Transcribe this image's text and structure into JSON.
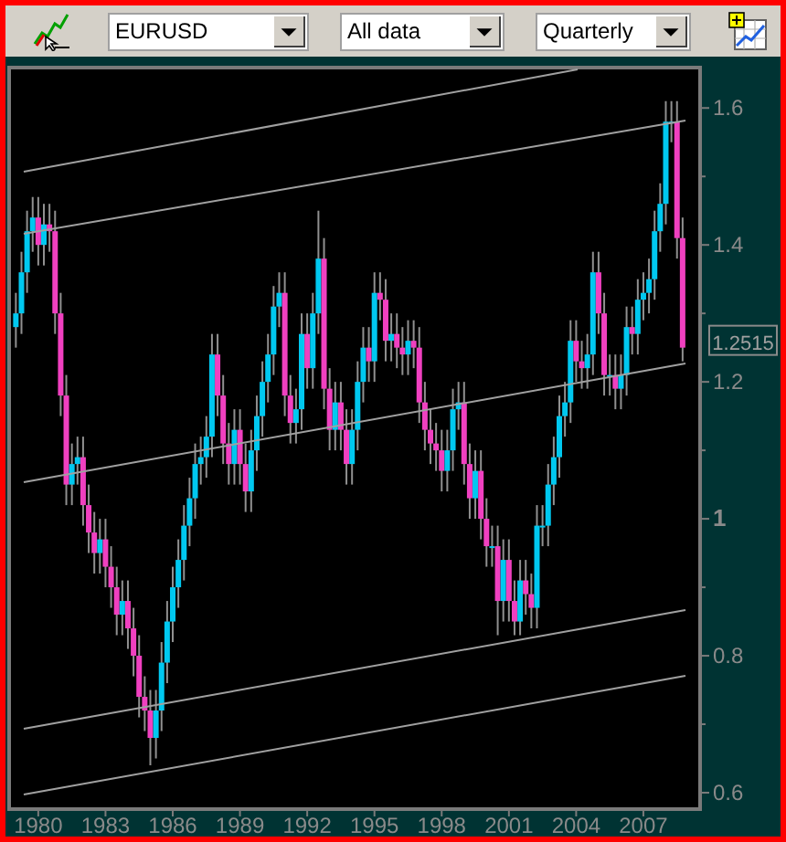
{
  "toolbar": {
    "symbol": {
      "value": "EURUSD"
    },
    "range": {
      "value": "All data"
    },
    "period": {
      "value": "Quarterly"
    }
  },
  "chart": {
    "price_label": "1.2515",
    "chart_data": {
      "type": "candlestick",
      "xlim": [
        1978.7,
        2009.53
      ],
      "ylim": [
        0.576,
        1.659
      ],
      "xticks": [
        1980,
        1983,
        1986,
        1989,
        1992,
        1995,
        1998,
        2001,
        2004,
        2007
      ],
      "yticks": [
        0.6,
        0.8,
        1,
        1.2,
        1.4,
        1.6
      ],
      "x": [
        1979,
        1979.25,
        1979.5,
        1979.75,
        1980,
        1980.25,
        1980.5,
        1980.75,
        1981,
        1981.25,
        1981.5,
        1981.75,
        1982,
        1982.25,
        1982.5,
        1982.75,
        1983,
        1983.25,
        1983.5,
        1983.75,
        1984,
        1984.25,
        1984.5,
        1984.75,
        1985,
        1985.25,
        1985.5,
        1985.75,
        1986,
        1986.25,
        1986.5,
        1986.75,
        1987,
        1987.25,
        1987.5,
        1987.75,
        1988,
        1988.25,
        1988.5,
        1988.75,
        1989,
        1989.25,
        1989.5,
        1989.75,
        1990,
        1990.25,
        1990.5,
        1990.75,
        1991,
        1991.25,
        1991.5,
        1991.75,
        1992,
        1992.25,
        1992.5,
        1992.75,
        1993,
        1993.25,
        1993.5,
        1993.75,
        1994,
        1994.25,
        1994.5,
        1994.75,
        1995,
        1995.25,
        1995.5,
        1995.75,
        1996,
        1996.25,
        1996.5,
        1996.75,
        1997,
        1997.25,
        1997.5,
        1997.75,
        1998,
        1998.25,
        1998.5,
        1998.75,
        1999,
        1999.25,
        1999.5,
        1999.75,
        2000,
        2000.25,
        2000.5,
        2000.75,
        2001,
        2001.25,
        2001.5,
        2001.75,
        2002,
        2002.25,
        2002.5,
        2002.75,
        2003,
        2003.25,
        2003.5,
        2003.75,
        2004,
        2004.25,
        2004.5,
        2004.75,
        2005,
        2005.25,
        2005.5,
        2005.75,
        2006,
        2006.25,
        2006.5,
        2006.75,
        2007,
        2007.25,
        2007.5,
        2007.75,
        2008,
        2008.25,
        2008.5,
        2008.75
      ],
      "ohlc": [
        [
          1.28,
          1.33,
          1.25,
          1.3
        ],
        [
          1.3,
          1.39,
          1.27,
          1.36
        ],
        [
          1.36,
          1.45,
          1.33,
          1.42
        ],
        [
          1.42,
          1.47,
          1.39,
          1.44
        ],
        [
          1.44,
          1.47,
          1.37,
          1.4
        ],
        [
          1.4,
          1.46,
          1.37,
          1.43
        ],
        [
          1.43,
          1.46,
          1.39,
          1.42
        ],
        [
          1.42,
          1.45,
          1.27,
          1.3
        ],
        [
          1.3,
          1.33,
          1.15,
          1.18
        ],
        [
          1.18,
          1.21,
          1.02,
          1.05
        ],
        [
          1.05,
          1.11,
          1.02,
          1.08
        ],
        [
          1.08,
          1.12,
          1.05,
          1.09
        ],
        [
          1.09,
          1.12,
          0.99,
          1.02
        ],
        [
          1.02,
          1.05,
          0.95,
          0.98
        ],
        [
          0.98,
          1.01,
          0.92,
          0.95
        ],
        [
          0.95,
          1.0,
          0.92,
          0.97
        ],
        [
          0.97,
          1.0,
          0.9,
          0.93
        ],
        [
          0.93,
          0.96,
          0.87,
          0.9
        ],
        [
          0.9,
          0.93,
          0.83,
          0.86
        ],
        [
          0.86,
          0.91,
          0.83,
          0.88
        ],
        [
          0.88,
          0.91,
          0.81,
          0.84
        ],
        [
          0.84,
          0.87,
          0.77,
          0.8
        ],
        [
          0.8,
          0.83,
          0.71,
          0.74
        ],
        [
          0.74,
          0.77,
          0.69,
          0.72
        ],
        [
          0.72,
          0.75,
          0.64,
          0.68
        ],
        [
          0.68,
          0.75,
          0.65,
          0.72
        ],
        [
          0.72,
          0.82,
          0.69,
          0.79
        ],
        [
          0.79,
          0.88,
          0.76,
          0.85
        ],
        [
          0.85,
          0.93,
          0.82,
          0.9
        ],
        [
          0.9,
          0.97,
          0.87,
          0.94
        ],
        [
          0.94,
          1.02,
          0.91,
          0.99
        ],
        [
          0.99,
          1.06,
          0.96,
          1.03
        ],
        [
          1.03,
          1.11,
          1.0,
          1.08
        ],
        [
          1.08,
          1.12,
          1.05,
          1.09
        ],
        [
          1.09,
          1.15,
          1.06,
          1.12
        ],
        [
          1.12,
          1.27,
          1.09,
          1.24
        ],
        [
          1.24,
          1.27,
          1.15,
          1.18
        ],
        [
          1.18,
          1.21,
          1.08,
          1.11
        ],
        [
          1.11,
          1.14,
          1.05,
          1.08
        ],
        [
          1.08,
          1.16,
          1.05,
          1.13
        ],
        [
          1.13,
          1.16,
          1.05,
          1.08
        ],
        [
          1.08,
          1.11,
          1.01,
          1.04
        ],
        [
          1.04,
          1.13,
          1.01,
          1.1
        ],
        [
          1.1,
          1.18,
          1.07,
          1.15
        ],
        [
          1.15,
          1.23,
          1.12,
          1.2
        ],
        [
          1.2,
          1.27,
          1.17,
          1.24
        ],
        [
          1.24,
          1.34,
          1.21,
          1.31
        ],
        [
          1.31,
          1.36,
          1.28,
          1.33
        ],
        [
          1.33,
          1.36,
          1.15,
          1.18
        ],
        [
          1.18,
          1.21,
          1.11,
          1.14
        ],
        [
          1.14,
          1.19,
          1.11,
          1.16
        ],
        [
          1.16,
          1.3,
          1.13,
          1.27
        ],
        [
          1.27,
          1.3,
          1.19,
          1.22
        ],
        [
          1.22,
          1.33,
          1.19,
          1.3
        ],
        [
          1.3,
          1.45,
          1.27,
          1.38
        ],
        [
          1.38,
          1.41,
          1.16,
          1.19
        ],
        [
          1.19,
          1.22,
          1.1,
          1.13
        ],
        [
          1.13,
          1.2,
          1.1,
          1.17
        ],
        [
          1.17,
          1.2,
          1.1,
          1.13
        ],
        [
          1.13,
          1.16,
          1.05,
          1.08
        ],
        [
          1.08,
          1.16,
          1.05,
          1.13
        ],
        [
          1.13,
          1.23,
          1.1,
          1.2
        ],
        [
          1.2,
          1.28,
          1.17,
          1.25
        ],
        [
          1.25,
          1.28,
          1.2,
          1.23
        ],
        [
          1.23,
          1.36,
          1.2,
          1.33
        ],
        [
          1.33,
          1.36,
          1.29,
          1.32
        ],
        [
          1.32,
          1.35,
          1.23,
          1.26
        ],
        [
          1.26,
          1.3,
          1.23,
          1.27
        ],
        [
          1.27,
          1.3,
          1.22,
          1.25
        ],
        [
          1.25,
          1.28,
          1.21,
          1.24
        ],
        [
          1.24,
          1.29,
          1.21,
          1.26
        ],
        [
          1.26,
          1.29,
          1.22,
          1.25
        ],
        [
          1.25,
          1.28,
          1.14,
          1.17
        ],
        [
          1.17,
          1.2,
          1.1,
          1.13
        ],
        [
          1.13,
          1.16,
          1.08,
          1.11
        ],
        [
          1.11,
          1.14,
          1.07,
          1.1
        ],
        [
          1.1,
          1.13,
          1.04,
          1.07
        ],
        [
          1.07,
          1.13,
          1.04,
          1.1
        ],
        [
          1.1,
          1.19,
          1.07,
          1.16
        ],
        [
          1.16,
          1.2,
          1.13,
          1.17
        ],
        [
          1.17,
          1.2,
          1.05,
          1.08
        ],
        [
          1.08,
          1.11,
          1.0,
          1.03
        ],
        [
          1.03,
          1.1,
          1.0,
          1.07
        ],
        [
          1.07,
          1.1,
          0.97,
          1.0
        ],
        [
          1.0,
          1.03,
          0.93,
          0.96
        ],
        [
          0.96,
          0.99,
          0.93,
          0.96
        ],
        [
          0.96,
          0.99,
          0.83,
          0.88
        ],
        [
          0.88,
          0.97,
          0.85,
          0.94
        ],
        [
          0.94,
          0.97,
          0.85,
          0.88
        ],
        [
          0.88,
          0.91,
          0.83,
          0.85
        ],
        [
          0.85,
          0.94,
          0.83,
          0.91
        ],
        [
          0.91,
          0.94,
          0.86,
          0.89
        ],
        [
          0.89,
          0.92,
          0.84,
          0.87
        ],
        [
          0.87,
          1.02,
          0.84,
          0.99
        ],
        [
          0.99,
          1.02,
          0.96,
          0.99
        ],
        [
          0.99,
          1.08,
          0.96,
          1.05
        ],
        [
          1.05,
          1.12,
          1.02,
          1.09
        ],
        [
          1.09,
          1.18,
          1.06,
          1.15
        ],
        [
          1.15,
          1.2,
          1.12,
          1.17
        ],
        [
          1.17,
          1.29,
          1.14,
          1.26
        ],
        [
          1.26,
          1.29,
          1.2,
          1.23
        ],
        [
          1.23,
          1.26,
          1.19,
          1.22
        ],
        [
          1.22,
          1.27,
          1.19,
          1.24
        ],
        [
          1.24,
          1.39,
          1.21,
          1.36
        ],
        [
          1.36,
          1.39,
          1.27,
          1.3
        ],
        [
          1.3,
          1.33,
          1.18,
          1.21
        ],
        [
          1.21,
          1.24,
          1.18,
          1.21
        ],
        [
          1.21,
          1.24,
          1.16,
          1.19
        ],
        [
          1.19,
          1.24,
          1.16,
          1.21
        ],
        [
          1.21,
          1.31,
          1.18,
          1.28
        ],
        [
          1.28,
          1.31,
          1.24,
          1.27
        ],
        [
          1.27,
          1.35,
          1.24,
          1.32
        ],
        [
          1.32,
          1.36,
          1.29,
          1.33
        ],
        [
          1.33,
          1.38,
          1.3,
          1.35
        ],
        [
          1.35,
          1.45,
          1.32,
          1.42
        ],
        [
          1.42,
          1.49,
          1.39,
          1.46
        ],
        [
          1.46,
          1.61,
          1.43,
          1.58
        ],
        [
          1.58,
          1.61,
          1.55,
          1.58
        ],
        [
          1.58,
          1.61,
          1.38,
          1.41
        ],
        [
          1.41,
          1.44,
          1.23,
          1.25
        ]
      ]
    }
  }
}
